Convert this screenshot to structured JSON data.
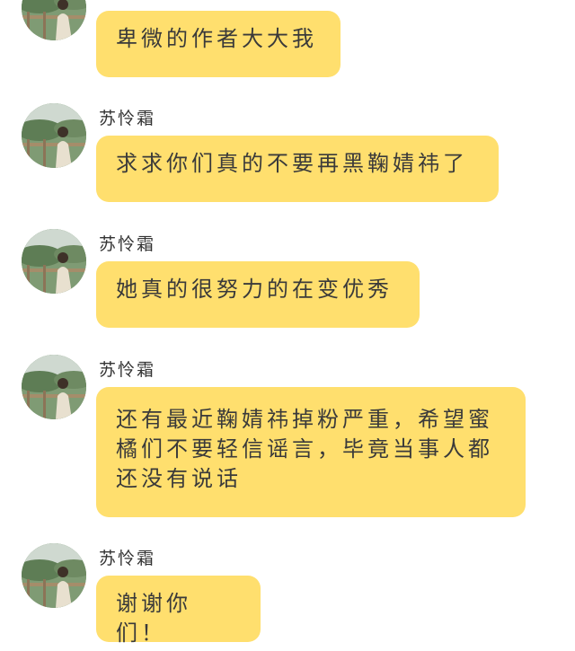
{
  "messages": [
    {
      "sender": "",
      "text": "卑微的作者大大我"
    },
    {
      "sender": "苏怜霜",
      "text": "求求你们真的不要再黑鞠婧祎了"
    },
    {
      "sender": "苏怜霜",
      "text": "她真的很努力的在变优秀"
    },
    {
      "sender": "苏怜霜",
      "text": "还有最近鞠婧祎掉粉严重，希望蜜橘们不要轻信谣言，毕竟当事人都还没有说话"
    },
    {
      "sender": "苏怜霜",
      "text": "谢谢你们！"
    }
  ],
  "colors": {
    "bubble": "#ffdf6e",
    "text": "#3a3a3a",
    "sender": "#333333",
    "background": "#ffffff"
  }
}
